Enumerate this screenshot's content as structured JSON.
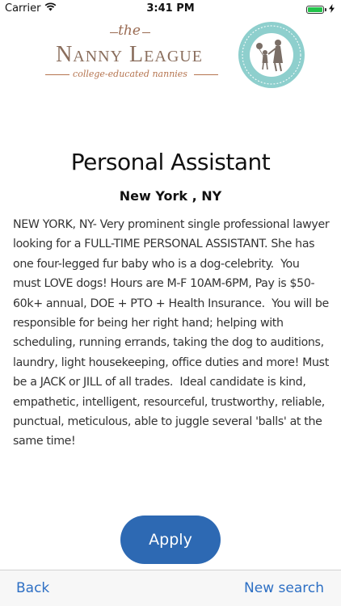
{
  "status_bar": {
    "carrier": "Carrier",
    "time": "3:41 PM",
    "battery_level": 1.0
  },
  "logo": {
    "the": "the",
    "name": "Nanny League",
    "tagline": "college-educated nannies"
  },
  "job": {
    "title": "Personal Assistant",
    "location": "New York , NY",
    "description": "NEW YORK, NY- Very prominent single professional lawyer looking for a FULL-TIME PERSONAL ASSISTANT. She has one four-legged fur baby who is a dog-celebrity.  You must LOVE dogs! Hours are M-F 10AM-6PM, Pay is $50-60k+ annual, DOE + PTO + Health Insurance.  You will be responsible for being her right hand; helping with scheduling, running errands, taking the dog to auditions, laundry, light housekeeping, office duties and more! Must be a JACK or JILL of all trades.  Ideal candidate is kind, empathetic, intelligent, resourceful, trustworthy, reliable, punctual, meticulous, able to juggle several 'balls' at the same time!"
  },
  "actions": {
    "apply_label": "Apply"
  },
  "toolbar": {
    "back_label": "Back",
    "new_search_label": "New search"
  },
  "colors": {
    "accent": "#2d69b3",
    "link": "#2d6fc4",
    "logo_brown": "#8a6e5d",
    "badge_teal": "#7fc7c5"
  }
}
